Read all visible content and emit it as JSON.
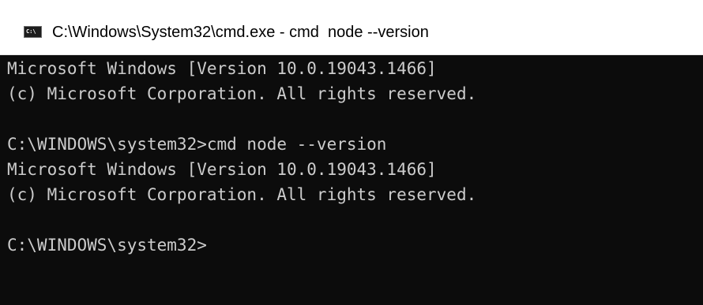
{
  "window": {
    "title": "C:\\Windows\\System32\\cmd.exe - cmd  node --version",
    "icon": "cmd-icon",
    "icon_label": "C:\\"
  },
  "console": {
    "background": "#0c0c0c",
    "foreground": "#cccccc",
    "lines": [
      "Microsoft Windows [Version 10.0.19043.1466]",
      "(c) Microsoft Corporation. All rights reserved.",
      "",
      "C:\\WINDOWS\\system32>cmd node --version",
      "Microsoft Windows [Version 10.0.19043.1466]",
      "(c) Microsoft Corporation. All rights reserved.",
      "",
      "C:\\WINDOWS\\system32>"
    ]
  }
}
